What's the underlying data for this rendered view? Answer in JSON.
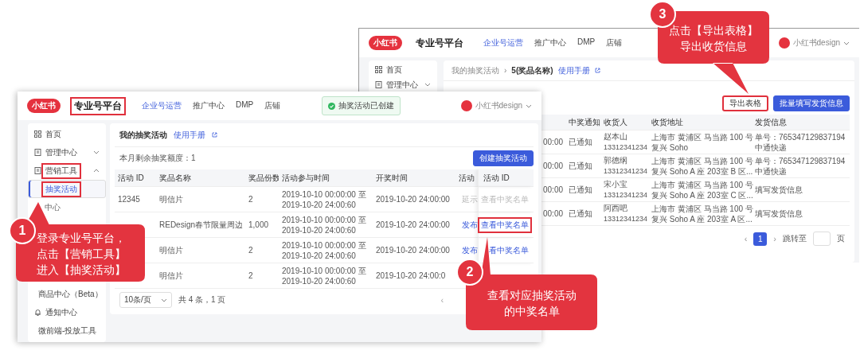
{
  "back_window": {
    "header": {
      "logo": "小红书",
      "title": "专业号平台",
      "nav": [
        {
          "label": "企业号运营",
          "selected": true
        },
        {
          "label": "推广中心",
          "selected": false
        },
        {
          "label": "DMP",
          "selected": false
        },
        {
          "label": "店铺",
          "selected": false
        }
      ],
      "user": "小红书design"
    },
    "sidebar": [
      {
        "label": "首页"
      },
      {
        "label": "管理中心",
        "expanded": false
      }
    ],
    "breadcrumb": {
      "parent": "我的抽奖活动",
      "separator": "›",
      "current": "5(奖品名称)",
      "help_link": "使用手册"
    },
    "buttons": [
      {
        "label": "导出表格",
        "kind": "default",
        "highlighted": true
      },
      {
        "label": "批量填写发货信息",
        "kind": "primary",
        "highlighted": false
      }
    ],
    "table": {
      "columns": [
        "中奖通知",
        "收货人",
        "收货地址",
        "发货信息"
      ],
      "rows": [
        {
          "column_1": "00:00",
          "notice": "已通知",
          "recipient": [
            "赵本山",
            "13312341234"
          ],
          "address": [
            "上海市 黄浦区 马当路 100 号",
            "复兴 Soho"
          ],
          "shipping": [
            "单号：765347129837194",
            "中通快递"
          ]
        },
        {
          "column_1": "00:00",
          "notice": "已通知",
          "recipient": [
            "郭德纲",
            "13312341234"
          ],
          "address": [
            "上海市 黄浦区 马当路 100 号",
            "复兴 Soho A 座 203室 B 区..."
          ],
          "shipping": [
            "单号：765347129837194",
            "中通快递"
          ]
        },
        {
          "column_1": "00:00",
          "notice": "已通知",
          "recipient": [
            "宋小宝",
            "13312341234"
          ],
          "address": [
            "上海市 黄浦区 马当路 100 号",
            "复兴 Soho A 座 203室 C 区..."
          ],
          "shipping_link": "填写发货信息"
        },
        {
          "column_1": "00:00",
          "notice": "已通知",
          "recipient": [
            "阿西吧",
            "13312341234"
          ],
          "address": [
            "上海市 黄浦区 马当路 100 号",
            "复兴 Soho A 座 203室 A 区..."
          ],
          "shipping_link": "填写发货信息"
        }
      ]
    },
    "pagination": {
      "prev": "‹",
      "pages": [
        {
          "label": "1",
          "selected": true
        }
      ],
      "next": "›",
      "jump_label": "跳转至",
      "unit": "页"
    }
  },
  "front_window": {
    "header": {
      "logo": "小红书",
      "title": "专业号平台",
      "title_highlighted": true,
      "nav": [
        {
          "label": "企业号运营",
          "selected": true
        },
        {
          "label": "推广中心",
          "selected": false
        },
        {
          "label": "DMP",
          "selected": false
        },
        {
          "label": "店铺",
          "selected": false
        }
      ],
      "toast": "抽奖活动已创建",
      "user": "小红书design"
    },
    "sidebar": [
      {
        "label": "首页"
      },
      {
        "label": "管理中心",
        "expanded": false
      },
      {
        "label": "营销工具",
        "expanded": true,
        "highlighted": true,
        "children": [
          {
            "label": "抽奖活动",
            "selected": true,
            "highlighted": true
          },
          {
            "label": "中心",
            "selected": false,
            "highlighted": false
          }
        ]
      },
      {
        "label": "商品中心（Beta）",
        "expanded": false
      },
      {
        "label": "通知中心"
      },
      {
        "label": "微前端-投放工具"
      }
    ],
    "card": {
      "title": "我的抽奖活动",
      "help_link": "使用手册",
      "quota": "本月剩余抽奖额度：1",
      "create_button": "创建抽奖活动"
    },
    "table": {
      "columns": [
        "活动 ID",
        "奖品名称",
        "奖品份数",
        "活动参与时间",
        "开奖时间",
        "活动"
      ],
      "fixed_column": "活动 ID",
      "rows": [
        {
          "id": "12345",
          "prize": "明信片",
          "count": "2",
          "period": [
            "2019-10-10 00:00:00 至",
            "2019-10-20 24:00:60"
          ],
          "draw_time": "2019-10-20 24:00:00",
          "status": {
            "label": "延示",
            "disabled": true
          },
          "action": {
            "label": "查看中奖名单",
            "disabled": true,
            "highlighted": false
          }
        },
        {
          "prize": "REDesign春节限量周边",
          "count": "1,000",
          "period": [
            "2019-10-10 00:00:00 至",
            "2019-10-20 24:00:60"
          ],
          "draw_time": "2019-10-20 24:00:00",
          "status": {
            "label": "发布",
            "disabled": false
          },
          "action": {
            "label": "查看中奖名单",
            "disabled": false,
            "highlighted": true
          }
        },
        {
          "prize": "明信片",
          "count": "2",
          "period": [
            "2019-10-10 00:00:00 至",
            "2019-10-20 24:00:60"
          ],
          "draw_time": "2019-10-20 24:00:00",
          "status": {
            "label": "发布",
            "disabled": false
          },
          "action": {
            "label": "看中奖名单",
            "disabled": false,
            "highlighted": false
          }
        },
        {
          "prize": "明信片",
          "count": "2",
          "period": [
            "2019-10-10 00:00:00 至",
            "2019-10-20 24:00:60"
          ],
          "draw_time": "2019-10-20 24:00:0"
        }
      ]
    },
    "footer": {
      "page_size": "10条/页",
      "total": "共 4 条，1 页",
      "prev": "‹"
    }
  },
  "callouts": [
    {
      "number": "1",
      "lines": [
        "登录专业号平台，",
        "点击【营销工具】",
        "进入【抽奖活动】"
      ]
    },
    {
      "number": "2",
      "lines": [
        "查看对应抽奖活动",
        "的中奖名单"
      ]
    },
    {
      "number": "3",
      "lines": [
        "点击【导出表格】",
        "导出收货信息"
      ]
    }
  ]
}
